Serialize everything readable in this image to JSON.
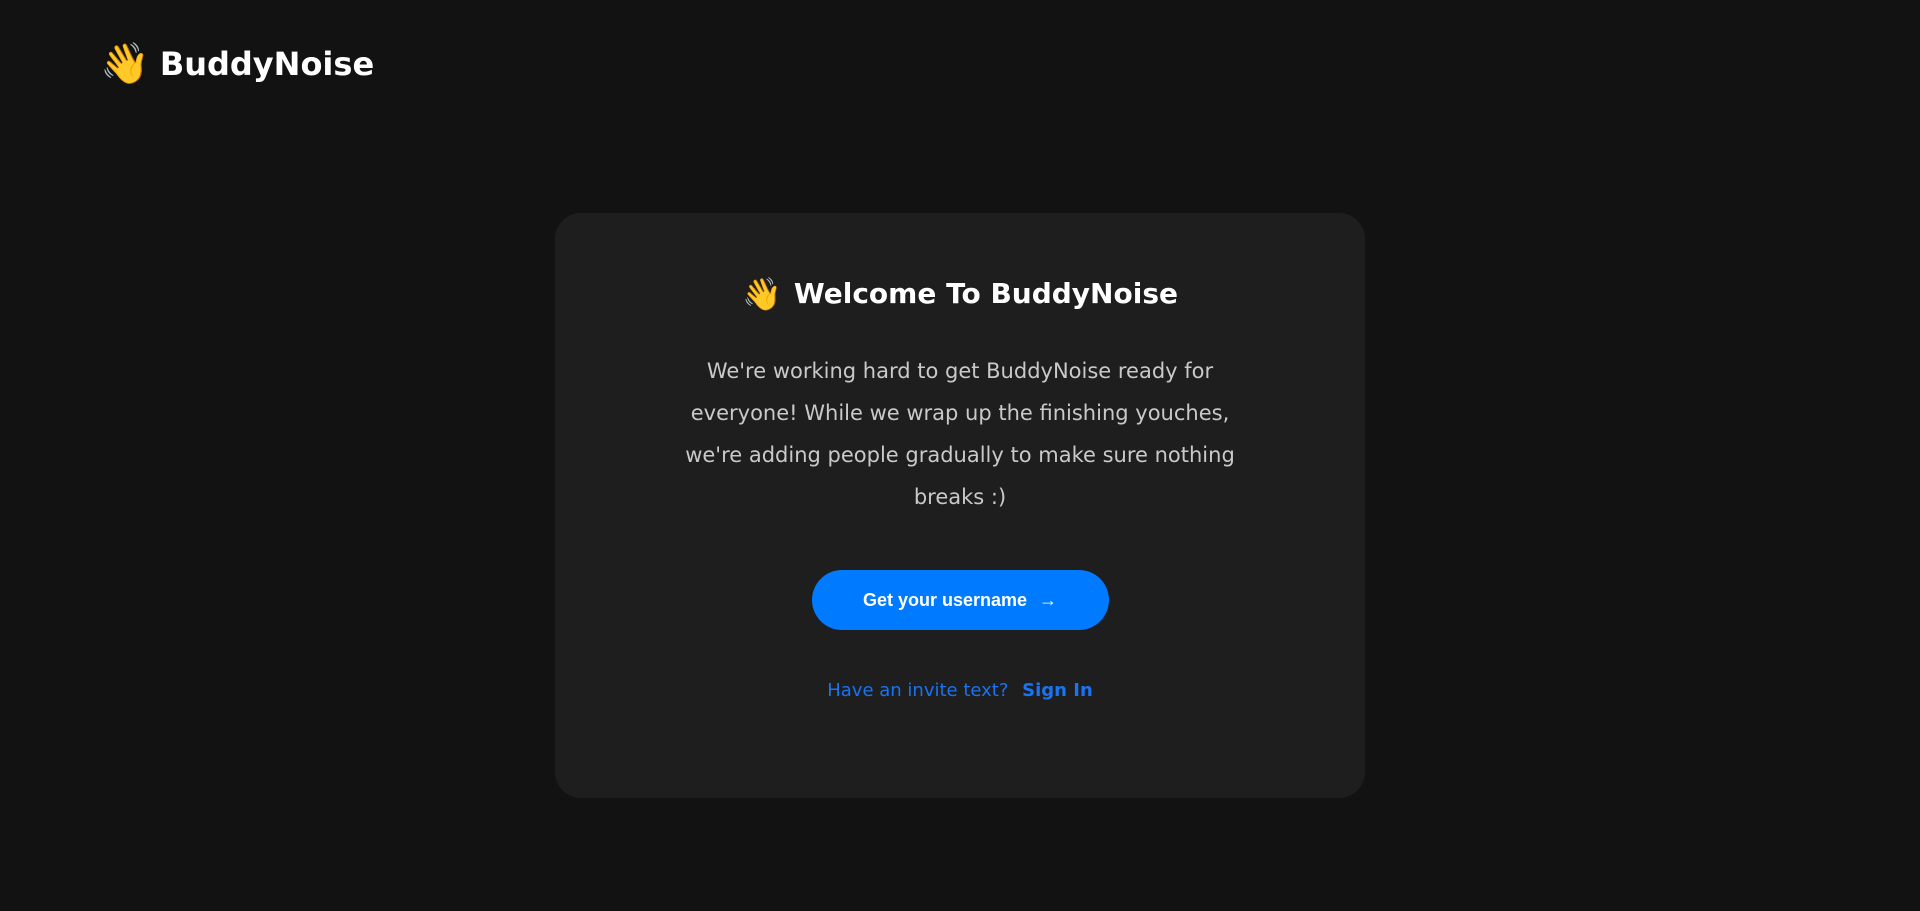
{
  "header": {
    "logo_icon": "waving-hand-icon",
    "logo_emoji": "👋",
    "brand": "BuddyNoise"
  },
  "card": {
    "title_emoji": "👋",
    "title": "Welcome To BuddyNoise",
    "description": "We're working hard to get BuddyNoise ready for everyone! While we wrap up the finishing youches, we're adding people gradually to make sure nothing breaks :)",
    "cta_label": "Get your username",
    "cta_arrow": "→",
    "invite_prompt": "Have an invite text?",
    "sign_in_label": "Sign In"
  },
  "colors": {
    "background": "#121212",
    "card": "#1e1e1e",
    "accent": "#007bff",
    "link": "#1a73f0"
  }
}
